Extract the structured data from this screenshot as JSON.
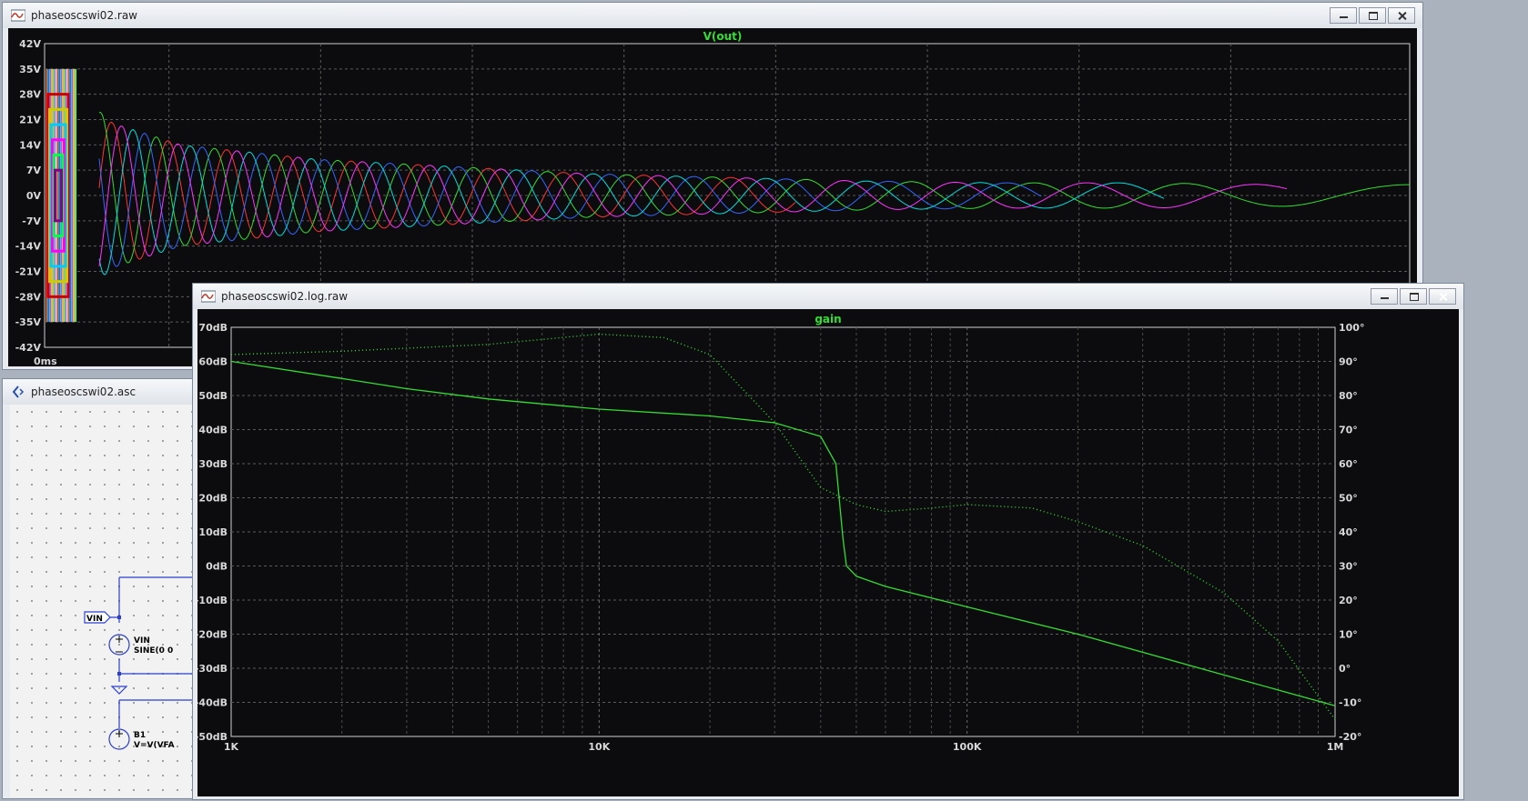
{
  "desktop": {
    "background": "#a9b2bd"
  },
  "transient_window": {
    "title": "phaseoscswi02.raw",
    "trace_label": "V(out)",
    "trace_color": "#33dd33",
    "x_start_label": "0ms",
    "y_ticks": [
      "42V",
      "35V",
      "28V",
      "21V",
      "14V",
      "7V",
      "0V",
      "-7V",
      "-14V",
      "-21V",
      "-28V",
      "-35V",
      "-42V"
    ]
  },
  "schematic_window": {
    "title": "phaseoscswi02.asc",
    "labels": {
      "net_flag": "VIN",
      "vin_name": "VIN",
      "vin_value": "SINE(0 0",
      "b1_name": "B1",
      "b1_value": "V=V(VFA"
    }
  },
  "ac_window": {
    "title": "phaseoscswi02.log.raw",
    "trace_label": "gain",
    "trace_color": "#33dd33",
    "left_ticks": [
      "70dB",
      "60dB",
      "50dB",
      "40dB",
      "30dB",
      "20dB",
      "10dB",
      "0dB",
      "-10dB",
      "-20dB",
      "-30dB",
      "-40dB",
      "-50dB"
    ],
    "right_ticks": [
      "100°",
      "90°",
      "80°",
      "70°",
      "60°",
      "50°",
      "40°",
      "30°",
      "20°",
      "10°",
      "0°",
      "-10°",
      "-20°"
    ],
    "x_ticks": [
      "1K",
      "10K",
      "100K",
      "1M"
    ]
  },
  "chart_data": [
    {
      "type": "line",
      "title": "V(out)",
      "xlabel": "",
      "ylabel": "",
      "ylim": [
        -42,
        42
      ],
      "xlim_label": "0ms",
      "series": [
        {
          "name": "V(out)",
          "envelope_points": [
            [
              0,
              35
            ],
            [
              0.02,
              30
            ],
            [
              0.05,
              20
            ],
            [
              0.1,
              14
            ],
            [
              0.2,
              10
            ],
            [
              0.3,
              8
            ],
            [
              0.4,
              6
            ],
            [
              0.5,
              5
            ],
            [
              0.6,
              4
            ],
            [
              0.7,
              3.5
            ],
            [
              0.8,
              3.5
            ],
            [
              0.9,
              3
            ],
            [
              1.0,
              3
            ]
          ]
        }
      ],
      "grid": true
    },
    {
      "type": "line",
      "title": "gain",
      "xlabel": "",
      "ylabel": "",
      "x_scale": "log",
      "xlim": [
        1000,
        1000000
      ],
      "ylim": [
        -50,
        70
      ],
      "y2lim": [
        -20,
        100
      ],
      "grid": true,
      "series": [
        {
          "name": "gain",
          "style": "solid",
          "points": [
            [
              1000,
              60
            ],
            [
              2000,
              55
            ],
            [
              3000,
              52
            ],
            [
              5000,
              49
            ],
            [
              10000,
              46
            ],
            [
              20000,
              44
            ],
            [
              30000,
              42
            ],
            [
              40000,
              38
            ],
            [
              44000,
              30
            ],
            [
              46000,
              8
            ],
            [
              47000,
              0
            ],
            [
              50000,
              -3
            ],
            [
              60000,
              -6
            ],
            [
              100000,
              -12
            ],
            [
              200000,
              -20
            ],
            [
              500000,
              -32
            ],
            [
              1000000,
              -41
            ]
          ]
        },
        {
          "name": "",
          "style": "dotted",
          "points": [
            [
              1000,
              92
            ],
            [
              2000,
              93
            ],
            [
              5000,
              95
            ],
            [
              10000,
              98
            ],
            [
              15000,
              97
            ],
            [
              20000,
              92
            ],
            [
              30000,
              72
            ],
            [
              40000,
              53
            ],
            [
              50000,
              48
            ],
            [
              60000,
              46
            ],
            [
              80000,
              47
            ],
            [
              100000,
              48
            ],
            [
              150000,
              47
            ],
            [
              200000,
              43
            ],
            [
              300000,
              36
            ],
            [
              500000,
              22
            ],
            [
              700000,
              8
            ],
            [
              1000000,
              -15
            ]
          ]
        }
      ]
    }
  ]
}
